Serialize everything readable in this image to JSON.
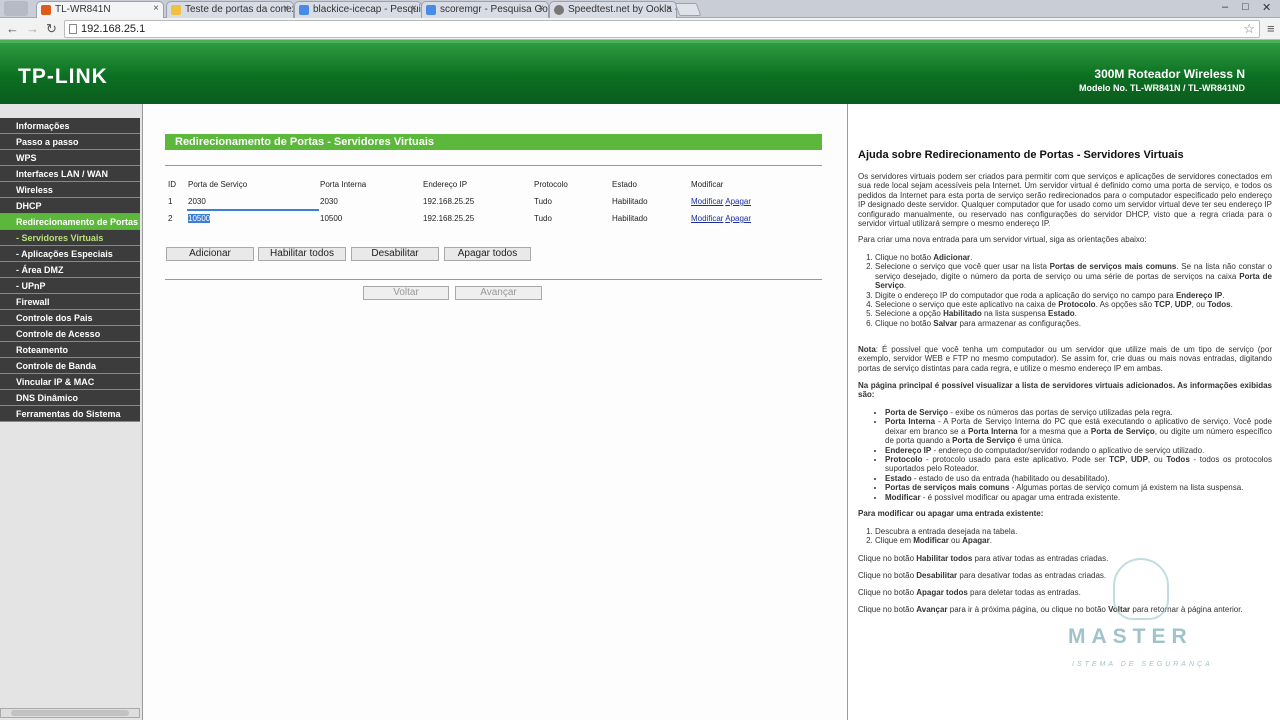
{
  "browser": {
    "tabs": [
      {
        "label": "TL-WR841N",
        "active": true,
        "icon_color": "#e05a1a"
      },
      {
        "label": "Teste de portas da conex",
        "active": false,
        "icon_color": "#f0c040"
      },
      {
        "label": "blackice-icecap - Pesquis",
        "active": false,
        "icon_color": "#4a8ae8"
      },
      {
        "label": "scoremgr - Pesquisa Goo",
        "active": false,
        "icon_color": "#4a8ae8"
      },
      {
        "label": "Speedtest.net by Ookla -",
        "active": false,
        "icon_color": "#777777"
      }
    ],
    "url": "192.168.25.1"
  },
  "header": {
    "logo": "TP-LINK",
    "model_title": "300M Roteador Wireless N",
    "model_number": "Modelo No. TL-WR841N / TL-WR841ND"
  },
  "sidebar": {
    "items": [
      {
        "label": "Informações",
        "state": "normal"
      },
      {
        "label": "Passo a passo",
        "state": "normal"
      },
      {
        "label": "WPS",
        "state": "normal"
      },
      {
        "label": "Interfaces LAN / WAN",
        "state": "normal"
      },
      {
        "label": "Wireless",
        "state": "normal"
      },
      {
        "label": "DHCP",
        "state": "normal"
      },
      {
        "label": "Redirecionamento de Portas",
        "state": "active"
      },
      {
        "label": "- Servidores Virtuais",
        "state": "subactive"
      },
      {
        "label": "- Aplicações Especiais",
        "state": "sub"
      },
      {
        "label": "- Área DMZ",
        "state": "sub"
      },
      {
        "label": "- UPnP",
        "state": "sub"
      },
      {
        "label": "Firewall",
        "state": "normal"
      },
      {
        "label": "Controle dos Pais",
        "state": "normal"
      },
      {
        "label": "Controle de Acesso",
        "state": "normal"
      },
      {
        "label": "Roteamento",
        "state": "normal"
      },
      {
        "label": "Controle de Banda",
        "state": "normal"
      },
      {
        "label": "Vincular IP & MAC",
        "state": "normal"
      },
      {
        "label": "DNS Dinâmico",
        "state": "normal"
      },
      {
        "label": "Ferramentas do Sistema",
        "state": "normal"
      }
    ]
  },
  "main": {
    "title": "Redirecionamento de Portas - Servidores Virtuais",
    "table": {
      "headers": [
        "ID",
        "Porta de Serviço",
        "Porta Interna",
        "Endereço IP",
        "Protocolo",
        "Estado",
        "Modificar"
      ],
      "rows": [
        {
          "id": "1",
          "service_port": "2030",
          "internal_port": "2030",
          "ip": "192.168.25.25",
          "protocol": "Tudo",
          "status": "Habilitado",
          "modify": "Modificar",
          "delete": "Apagar"
        },
        {
          "id": "2",
          "service_port": "10500",
          "internal_port": "10500",
          "ip": "192.168.25.25",
          "protocol": "Tudo",
          "status": "Habilitado",
          "modify": "Modificar",
          "delete": "Apagar"
        }
      ]
    },
    "buttons": {
      "add": "Adicionar",
      "enable_all": "Habilitar todos",
      "disable": "Desabilitar",
      "delete_all": "Apagar todos",
      "back": "Voltar",
      "next": "Avançar"
    }
  },
  "help": {
    "title": "Ajuda sobre Redirecionamento de Portas - Servidores Virtuais",
    "intro": "Os servidores virtuais podem ser criados para permitir com que serviços e aplicações de servidores conectados em sua rede local sejam acessíveis pela Internet. Um servidor virtual é definido como uma porta de serviço, e todos os pedidos da Internet para esta porta de serviço serão redirecionados para o computador especificado pelo endereço IP designado deste servidor. Qualquer computador que for usado como um servidor virtual deve ter seu endereço IP configurado manualmente, ou reservado nas configurações do servidor DHCP, visto que a regra criada para o servidor virtual utilizará sempre o mesmo endereço IP.",
    "create_heading": "Para criar uma nova entrada para um servidor virtual, siga as orientações abaixo:",
    "create_steps": [
      "Clique no botão <b>Adicionar</b>.",
      "Selecione o serviço que você quer usar na lista <b>Portas de serviços mais comuns</b>. Se na lista não constar o serviço desejado, digite o número da porta de serviço ou uma série de portas de serviços na caixa <b>Porta de Serviço</b>.",
      "Digite o endereço IP do computador que roda a aplicação do serviço no campo para <b>Endereço IP</b>.",
      "Selecione o serviço que este aplicativo na caixa de <b>Protocolo</b>. As opções são <b>TCP</b>, <b>UDP</b>, ou <b>Todos</b>.",
      "Selecione a opção <b>Habilitado</b> na lista suspensa <b>Estado</b>.",
      "Clique no botão <b>Salvar</b> para armazenar as configurações."
    ],
    "note": "<b>Nota</b>: É possível que você tenha um computador ou um servidor que utilize mais de um tipo de serviço (por exemplo, servidor WEB e FTP no mesmo computador). Se assim for, crie duas ou mais novas entradas, digitando portas de serviço distintas para cada regra, e utilize o mesmo endereço IP em ambas.",
    "list_heading": "Na página principal é possível visualizar a lista de servidores virtuais adicionados. As informações exibidas são:",
    "list_items": [
      "<b>Porta de Serviço</b> - exibe os números das portas de serviço utilizadas pela regra.",
      "<b>Porta Interna</b> - A Porta de Serviço Interna do PC que está executando o aplicativo de serviço. Você pode deixar em branco se a <b>Porta Interna</b> for a mesma que a <b>Porta de Serviço</b>, ou digite um número específico de porta quando a <b>Porta de Serviço</b> é uma única.",
      "<b>Endereço IP</b> - endereço do computador/servidor rodando o aplicativo de serviço utilizado.",
      "<b>Protocolo</b> - protocolo usado para este aplicativo. Pode ser <b>TCP</b>, <b>UDP</b>, ou <b>Todos</b> - todos os protocolos suportados pelo Roteador.",
      "<b>Estado</b> - estado de uso da entrada (habilitado ou desabilitado).",
      "<b>Portas de serviços mais comuns</b> - Algumas portas de serviço comum já existem na lista suspensa.",
      "<b>Modificar</b> - é possível modificar ou apagar uma entrada existente."
    ],
    "modify_heading": "Para modificar ou apagar uma entrada existente:",
    "modify_steps": [
      "Descubra a entrada desejada na tabela.",
      "Clique em <b>Modificar</b> ou <b>Apagar</b>."
    ],
    "p_enable": "Clique no botão <b>Habilitar todos</b> para ativar todas as entradas criadas.",
    "p_disable": "Clique no botão <b>Desabilitar</b> para desativar todas as entradas criadas.",
    "p_delete": "Clique no botão <b>Apagar todos</b> para deletar todas as entradas.",
    "p_next": "Clique no botão <b>Avançar</b> para ir à próxima página, ou clique no botão <b>Voltar</b> para retornar à página anterior."
  },
  "watermark": {
    "text": "MASTER",
    "subtext": "ISTEMA DE SEGURANÇA"
  }
}
